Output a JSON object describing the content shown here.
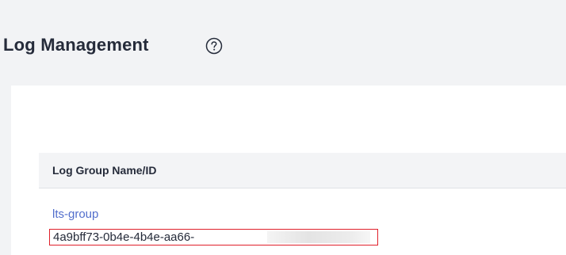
{
  "header": {
    "title": "Log Management",
    "help_icon": "question-circle-icon"
  },
  "table": {
    "columns": [
      "Log Group Name/ID"
    ],
    "rows": [
      {
        "name": "lts-group",
        "id": "4a9bff73-0b4e-4b4e-aa66-",
        "id_highlighted": true
      }
    ]
  },
  "colors": {
    "link": "#526ecc",
    "highlight_border": "#e0202b",
    "text": "#252b3a",
    "header_bg": "#f3f4f6"
  }
}
